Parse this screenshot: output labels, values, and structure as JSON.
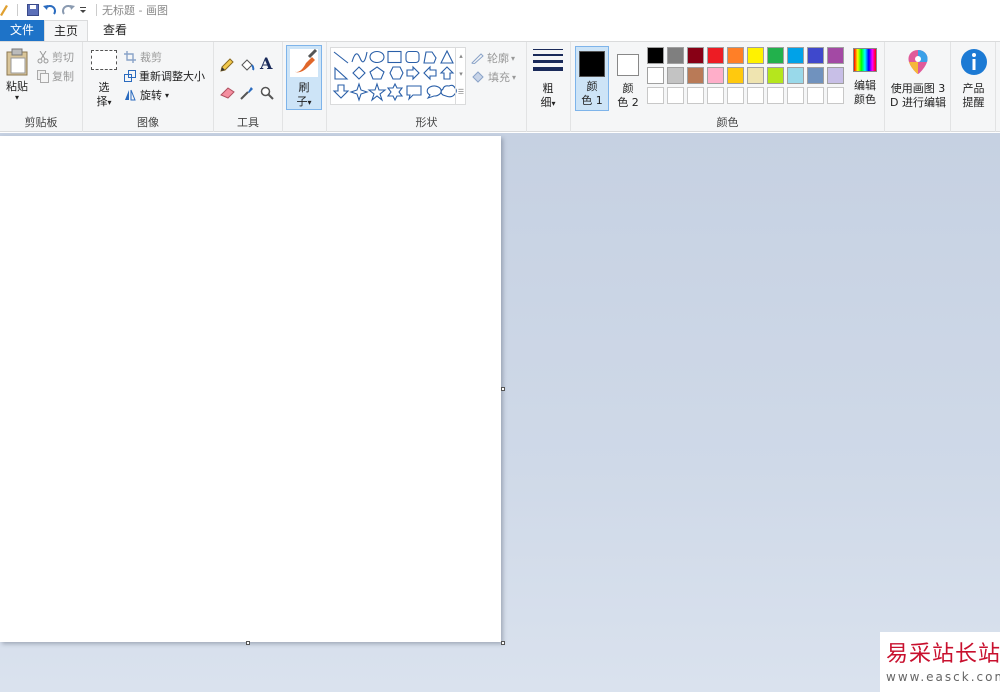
{
  "window": {
    "title": "无标题 - 画图"
  },
  "tabs": {
    "file": "文件",
    "home": "主页",
    "view": "查看"
  },
  "clipboard": {
    "paste": "粘贴",
    "cut": "剪切",
    "copy": "复制",
    "group": "剪贴板"
  },
  "image": {
    "select_1": "选",
    "select_2": "择",
    "crop": "裁剪",
    "resize": "重新调整大小",
    "rotate": "旋转",
    "group": "图像"
  },
  "tools": {
    "group": "工具",
    "text_glyph": "A"
  },
  "brushes": {
    "label_1": "刷",
    "label_2": "子"
  },
  "shapes": {
    "outline": "轮廓",
    "fill": "填充",
    "group": "形状"
  },
  "size": {
    "label_1": "粗",
    "label_2": "细"
  },
  "colors": {
    "color1_1": "颜",
    "color1_2": "色 1",
    "color2_1": "颜",
    "color2_2": "色 2",
    "edit_1": "编辑",
    "edit_2": "颜色",
    "group": "颜色",
    "color1_value": "#000000",
    "color2_value": "#ffffff",
    "palette_row1": [
      "#000000",
      "#7f7f7f",
      "#880015",
      "#ed1c24",
      "#ff7f27",
      "#fff200",
      "#22b14c",
      "#00a2e8",
      "#3f48cc",
      "#a349a4"
    ],
    "palette_row2": [
      "#ffffff",
      "#c3c3c3",
      "#b97a57",
      "#ffaec9",
      "#ffc90e",
      "#efe4b0",
      "#b5e61d",
      "#99d9ea",
      "#7092be",
      "#c8bfe7"
    ],
    "palette_row3": [
      "#ffffff",
      "#ffffff",
      "#ffffff",
      "#ffffff",
      "#ffffff",
      "#ffffff",
      "#ffffff",
      "#ffffff",
      "#ffffff",
      "#ffffff"
    ]
  },
  "paint3d": {
    "label_1": "使用画图 3",
    "label_2": "D 进行编辑"
  },
  "product": {
    "label_1": "产品",
    "label_2": "提醒"
  },
  "watermark": {
    "line1": "易采站长站",
    "line2": "www.easck.com"
  }
}
